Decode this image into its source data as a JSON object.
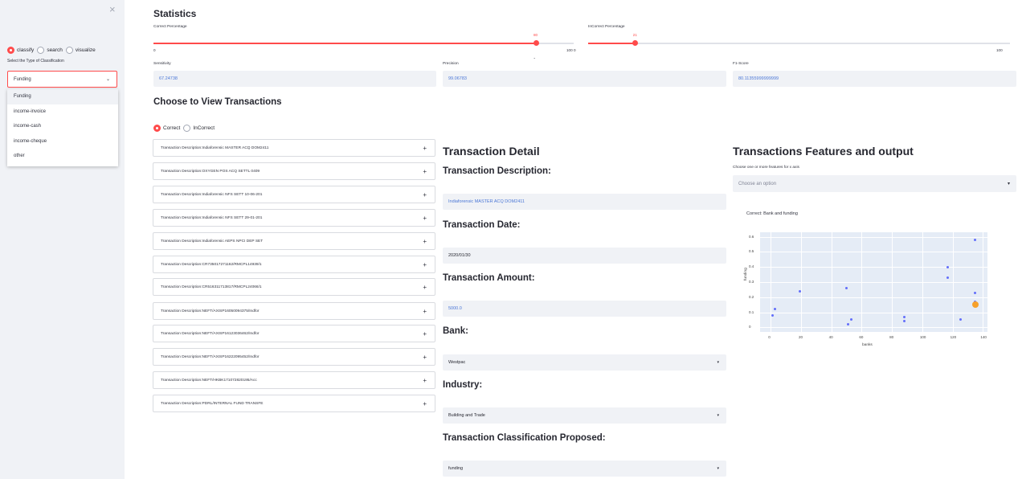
{
  "sidebar": {
    "close_label": "×",
    "modes": [
      "classify",
      "search",
      "visualize"
    ],
    "selected_mode": "classify",
    "classification_label": "Select the Type of Classification",
    "classification_value": "Funding",
    "dropdown_options": [
      "Funding",
      "income-invoice",
      "income-cash",
      "income-cheque",
      "other"
    ]
  },
  "stats": {
    "title": "Statistics",
    "correct_label": "Correct Percentage",
    "correct_value": "80",
    "incorrect_label": "InCorrect Percentage",
    "incorrect_value": "21",
    "tick_min": "0",
    "tick_max": "100",
    "correct_fraction": 0.8,
    "incorrect_fraction": 0.21,
    "dot_mark": "."
  },
  "metrics": {
    "sensitivity_label": "Sensitivity",
    "sensitivity_value": "67.24738",
    "precision_label": "Precision",
    "precision_value": "99.06783",
    "f1_label": "F1-Score",
    "f1_value": "80.11355999999999"
  },
  "transactions": {
    "title": "Choose to View Transactions",
    "options": [
      "Correct",
      "InCorrect"
    ],
    "selected": "Correct",
    "items": [
      "Transaction Description:Indiaforensic MASTER ACQ DOM2411",
      "Transaction Description:OXYGEN POS ACQ SETTL 0409",
      "Transaction Description:Indiaforensic NFS SETT 10-06-201",
      "Transaction Description:Indiaforensic NFS SETT 29-01-201",
      "Transaction Description:Indiaforensic AEPS NPCI DEP SET",
      "Transaction Description:CR735017271162/RMCPL14939/1",
      "Transaction Description:CR516311713817/RMCPL24066/1",
      "Transaction Description:NEFT/AXISP16050094375/Indfor",
      "Transaction Description:NEFT/AXISP16123036462/Indfor",
      "Transaction Description:NEFT/AXISP16222095452/Indfor",
      "Transaction Description:NEFT/HKBK171072820195/Acc",
      "Transaction Description:PDRL/INTERNAL FUND TRANSFE"
    ],
    "expand_icon": "+"
  },
  "detail": {
    "title": "Transaction Detail",
    "description_label": "Transaction Description:",
    "description_value": "Indiaforensic MASTER ACQ DOM2411",
    "date_label": "Transaction Date:",
    "date_value": "2020/01/30",
    "amount_label": "Transaction Amount:",
    "amount_value": "5000.0",
    "bank_label": "Bank:",
    "bank_value": "Westpac",
    "industry_label": "Industry:",
    "industry_value": "Building and Trade",
    "classification_label": "Transaction Classification Proposed:",
    "classification_value": "funding"
  },
  "features": {
    "title": "Transactions Features and output",
    "select_label": "Choose one or more features for x axis",
    "select_placeholder": "Choose an option"
  },
  "chart_data": {
    "type": "scatter",
    "title": "Correct: Bank and funding",
    "xlabel": "banks",
    "ylabel": "funding",
    "xlim": [
      -7,
      143
    ],
    "ylim": [
      -0.03,
      0.63
    ],
    "x_ticks": [
      "0",
      "20",
      "40",
      "60",
      "80",
      "100",
      "120",
      "140"
    ],
    "y_ticks": [
      "0",
      "0.1",
      "0.2",
      "0.3",
      "0.4",
      "0.5",
      "0.6"
    ],
    "series": [
      {
        "x": [
          1,
          3,
          19,
          50,
          51,
          53,
          88,
          88,
          117,
          117,
          125,
          135,
          135,
          135
        ],
        "y": [
          0.08,
          0.12,
          0.24,
          0.26,
          0.02,
          0.05,
          0.07,
          0.04,
          0.4,
          0.33,
          0.05,
          0.58,
          0.23,
          0.17
        ]
      }
    ],
    "highlight": {
      "x": 135,
      "y": 0.15,
      "color": "#f7a12b"
    },
    "colors": {
      "points": "#636efa",
      "background": "#e5ecf6"
    }
  },
  "colors": {
    "accent": "#ff4b4b",
    "value_text": "#4b77d6",
    "sidebar_bg": "#f0f2f6"
  }
}
